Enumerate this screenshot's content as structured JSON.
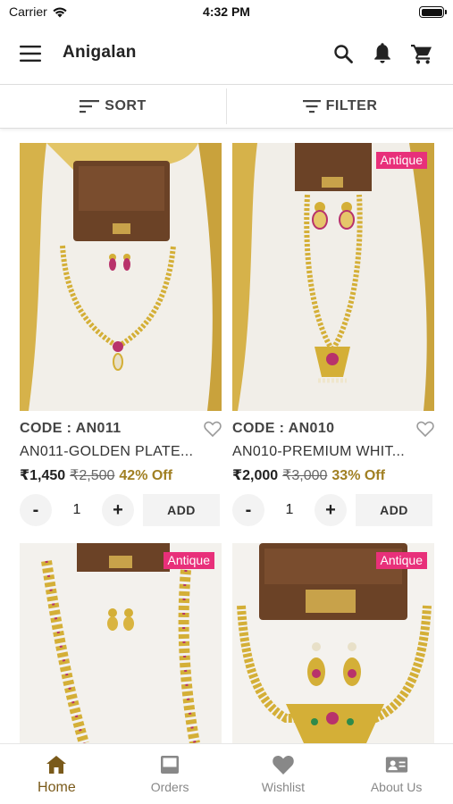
{
  "status_bar": {
    "carrier": "Carrier",
    "time": "4:32 PM"
  },
  "app_bar": {
    "title": "Anigalan"
  },
  "toolbar": {
    "sort_label": "SORT",
    "filter_label": "FILTER"
  },
  "products": [
    {
      "code": "CODE : AN011",
      "name": "AN011-GOLDEN PLATE...",
      "price": "₹1,450",
      "mrp": "₹2,500",
      "discount": "42% Off",
      "qty": "1",
      "add_label": "ADD",
      "minus": "-",
      "plus": "+"
    },
    {
      "badge": "Antique",
      "code": "CODE : AN010",
      "name": "AN010-PREMIUM WHIT...",
      "price": "₹2,000",
      "mrp": "₹3,000",
      "discount": "33% Off",
      "qty": "1",
      "add_label": "ADD",
      "minus": "-",
      "plus": "+"
    },
    {
      "badge": "Antique"
    },
    {
      "badge": "Antique"
    }
  ],
  "bottom_nav": [
    {
      "label": "Home",
      "icon": "home-icon",
      "active": true
    },
    {
      "label": "Orders",
      "icon": "inbox-icon"
    },
    {
      "label": "Wishlist",
      "icon": "heart-icon"
    },
    {
      "label": "About Us",
      "icon": "contact-card-icon"
    }
  ],
  "colors": {
    "accent": "#7a5a1a",
    "badge": "#e8307a",
    "discount": "#a07f22"
  }
}
